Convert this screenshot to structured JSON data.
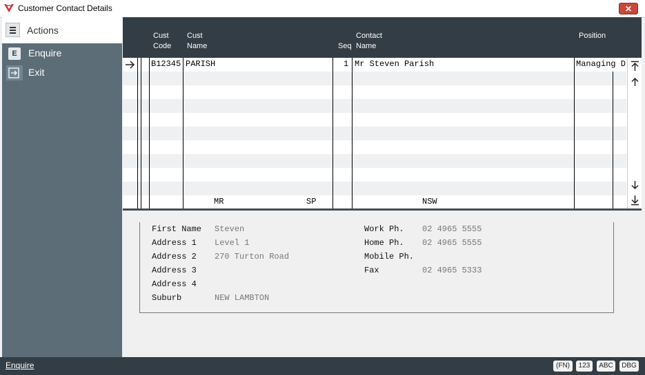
{
  "window": {
    "title": "Customer Contact Details",
    "close_label": "✕"
  },
  "sidebar": {
    "header_label": "Actions",
    "actions": [
      {
        "key": "E",
        "label": "Enquire"
      },
      {
        "key": "",
        "label": "Exit"
      }
    ]
  },
  "grid": {
    "headers": {
      "cust_code": [
        "Cust",
        "Code"
      ],
      "cust_name": [
        "Cust",
        "Name"
      ],
      "seq": "Seq",
      "contact_name": [
        "Contact",
        "Name"
      ],
      "position": "Position"
    },
    "rows": [
      {
        "cust_code": "B12345",
        "cust_name": "PARISH",
        "seq": "1",
        "contact_name": "Mr Steven Parish",
        "position": "Managing D"
      }
    ],
    "footer": {
      "title": "MR",
      "state_left": "SP",
      "state": "NSW"
    }
  },
  "details": {
    "left": [
      {
        "label": "First Name",
        "value": "Steven"
      },
      {
        "label": "Address 1",
        "value": "Level 1"
      },
      {
        "label": "Address 2",
        "value": "270 Turton Road"
      },
      {
        "label": "Address 3",
        "value": ""
      },
      {
        "label": "Address 4",
        "value": ""
      },
      {
        "label": "Suburb",
        "value": "NEW LAMBTON"
      }
    ],
    "right": [
      {
        "label": "Work Ph.",
        "value": "02 4965 5555"
      },
      {
        "label": "Home Ph.",
        "value": "02 4965 5555"
      },
      {
        "label": "Mobile Ph.",
        "value": ""
      },
      {
        "label": "Fax",
        "value": "02 4965 5333"
      }
    ]
  },
  "statusbar": {
    "mode": "Enquire",
    "buttons": [
      "(FN)",
      "123",
      "ABC",
      "DBG"
    ]
  }
}
